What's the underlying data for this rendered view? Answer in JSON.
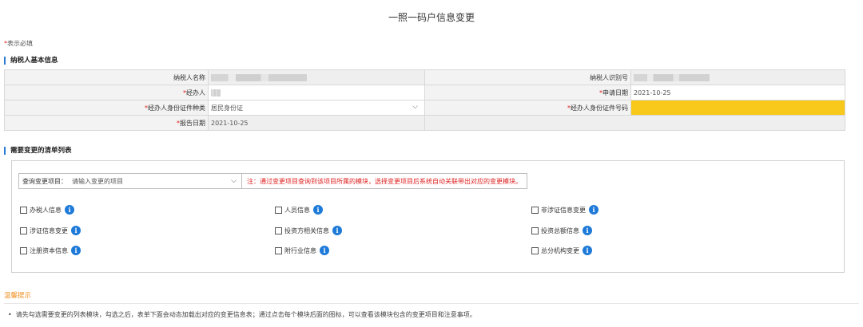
{
  "page_title": "一照一码户信息变更",
  "required_note": {
    "star": "*",
    "text": "表示必填"
  },
  "section_basic": "纳税人基本信息",
  "section_list": "需要变更的清单列表",
  "basic_info": {
    "taxpayer_name_label": "纳税人名称",
    "taxpayer_id_label": "纳税人识别号",
    "agent_label": "经办人",
    "apply_date_label": "申请日期",
    "apply_date_value": "2021-10-25",
    "agent_id_type_label": "经办人身份证件种类",
    "agent_id_type_value": "居民身份证",
    "agent_id_number_label": "经办人身份证件号码",
    "report_date_label": "报告日期",
    "report_date_value": "2021-10-25",
    "required_star": "*"
  },
  "query": {
    "label": "查询变更项目：",
    "placeholder": "请输入变更的项目",
    "note": "注：通过变更项目查询到该项目所属的模块，选择变更项目后系统自动关联带出对应的变更模块。"
  },
  "modules": [
    {
      "label": "办税人信息"
    },
    {
      "label": "人员信息"
    },
    {
      "label": "非涉证信息变更"
    },
    {
      "label": "涉证信息变更"
    },
    {
      "label": "投资方相关信息"
    },
    {
      "label": "投资总额信息"
    },
    {
      "label": "注册资本信息"
    },
    {
      "label": "附行业信息"
    },
    {
      "label": "总分机构变更"
    }
  ],
  "tips": {
    "title": "温馨提示",
    "text": "请先勾选需要变更的列表模块，勾选之后，表单下面会动态加载出对应的变更信息表；通过点击每个模块后面的图标，可以查看该模块包含的变更项目和注意事项。"
  },
  "colors": {
    "accent": "#1e7ad8",
    "required": "#e02020",
    "highlight": "#f8c91a",
    "tip": "#f08c1a"
  },
  "icons": {
    "info": "info-icon",
    "dropdown": "chevron-down-icon"
  }
}
